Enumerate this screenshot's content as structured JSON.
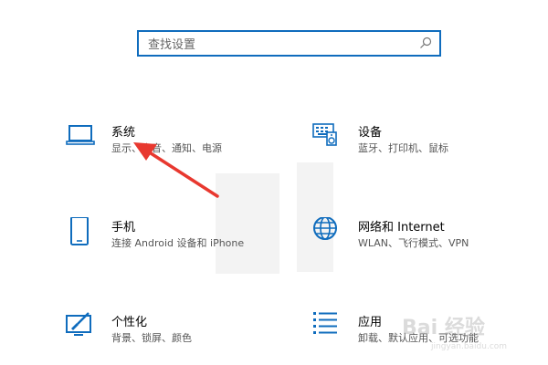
{
  "search": {
    "placeholder": "查找设置"
  },
  "tiles": [
    {
      "icon": "laptop-icon",
      "title": "系统",
      "desc": "显示、声音、通知、电源"
    },
    {
      "icon": "keyboard-speaker-icon",
      "title": "设备",
      "desc": "蓝牙、打印机、鼠标"
    },
    {
      "icon": "phone-icon",
      "title": "手机",
      "desc": "连接 Android 设备和 iPhone"
    },
    {
      "icon": "globe-icon",
      "title": "网络和 Internet",
      "desc": "WLAN、飞行模式、VPN"
    },
    {
      "icon": "paint-brush-icon",
      "title": "个性化",
      "desc": "背景、锁屏、颜色"
    },
    {
      "icon": "list-icon",
      "title": "应用",
      "desc": "卸载、默认应用、可选功能"
    }
  ],
  "colors": {
    "accent": "#0f6cbd",
    "arrow": "#e8382f"
  },
  "watermark": {
    "text": "Bai 经验",
    "url": "jingyan.baidu.com"
  }
}
